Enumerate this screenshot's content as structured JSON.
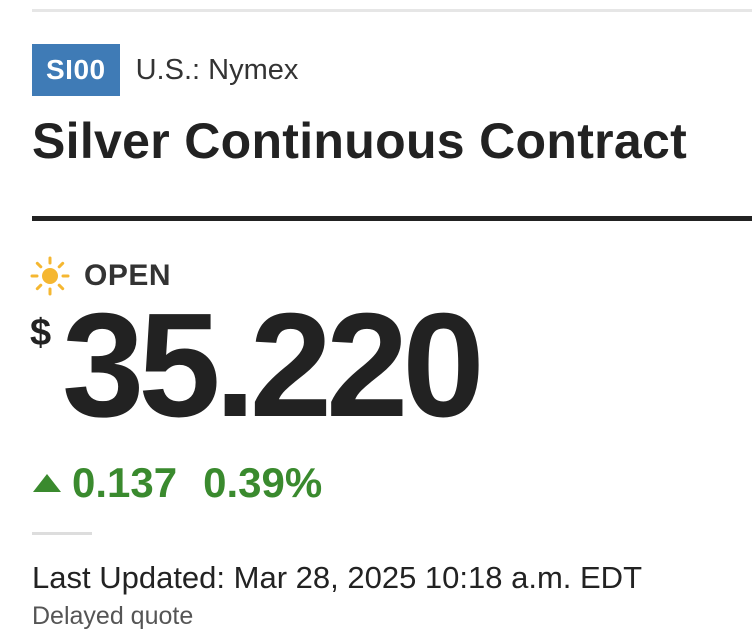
{
  "header": {
    "ticker": "SI00",
    "exchange": "U.S.: Nymex",
    "title": "Silver Continuous Contract"
  },
  "status": {
    "icon": "sun-icon",
    "label": "OPEN"
  },
  "quote": {
    "currency_symbol": "$",
    "price": "35.220",
    "change_direction_icon": "up-arrow-icon",
    "change": "0.137",
    "change_percent": "0.39%"
  },
  "footer": {
    "last_updated": "Last Updated: Mar 28, 2025 10:18 a.m. EDT",
    "delay_note": "Delayed quote"
  },
  "colors": {
    "ticker_badge": "#3f7bb6",
    "positive": "#3a8a2e",
    "sun": "#f5b731",
    "text": "#222222"
  }
}
